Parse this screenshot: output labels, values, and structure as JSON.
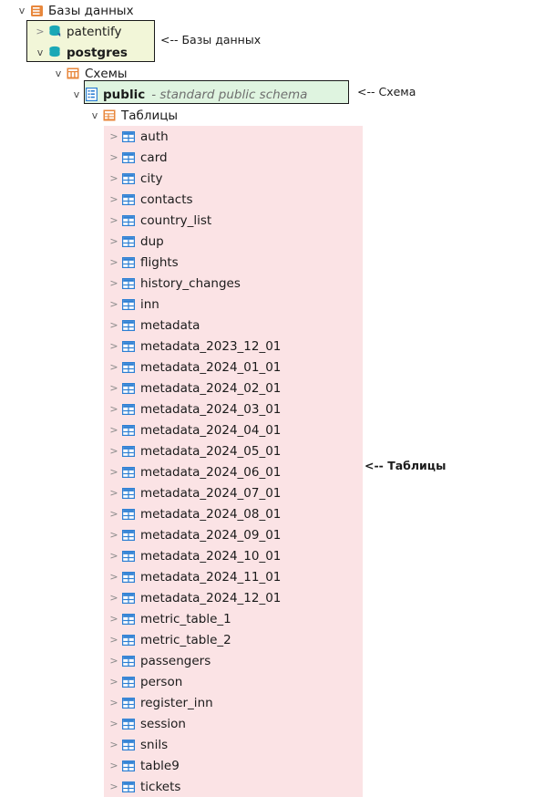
{
  "colors": {
    "db_box_fill": "#f2f6d8",
    "schema_box_fill": "#dff4e0",
    "tables_band_fill": "#fbe3e5",
    "box_border": "#1a1a1a",
    "folder_orange": "#e8873c",
    "database_teal": "#1ba8b6",
    "table_blue": "#2d7fd3",
    "schema_icon_blue": "#2d7fd3"
  },
  "tree": {
    "root": {
      "label": "Базы данных",
      "twisty": "v",
      "icon": "server-stack-icon"
    },
    "databases": [
      {
        "label": "patentify",
        "twisty": ">",
        "icon": "database-icon",
        "bold": false
      },
      {
        "label": "postgres",
        "twisty": "v",
        "icon": "database-icon",
        "bold": true
      }
    ],
    "schemas_node": {
      "label": "Схемы",
      "twisty": "v",
      "icon": "schemas-grid-icon"
    },
    "schema": {
      "label": "public",
      "description": "- standard public schema",
      "twisty": "v",
      "icon": "schema-document-icon"
    },
    "tables_node": {
      "label": "Таблицы",
      "twisty": "v",
      "icon": "tables-folder-icon"
    },
    "tables": [
      "auth",
      "card",
      "city",
      "contacts",
      "country_list",
      "dup",
      "flights",
      "history_changes",
      "inn",
      "metadata",
      "metadata_2023_12_01",
      "metadata_2024_01_01",
      "metadata_2024_02_01",
      "metadata_2024_03_01",
      "metadata_2024_04_01",
      "metadata_2024_05_01",
      "metadata_2024_06_01",
      "metadata_2024_07_01",
      "metadata_2024_08_01",
      "metadata_2024_09_01",
      "metadata_2024_10_01",
      "metadata_2024_11_01",
      "metadata_2024_12_01",
      "metric_table_1",
      "metric_table_2",
      "passengers",
      "person",
      "register_inn",
      "session",
      "snils",
      "table9",
      "tickets"
    ],
    "table_twisty": ">"
  },
  "annotations": {
    "databases": "<-- Базы данных",
    "schema": "<-- Схема",
    "tables": "<-- Таблицы"
  }
}
